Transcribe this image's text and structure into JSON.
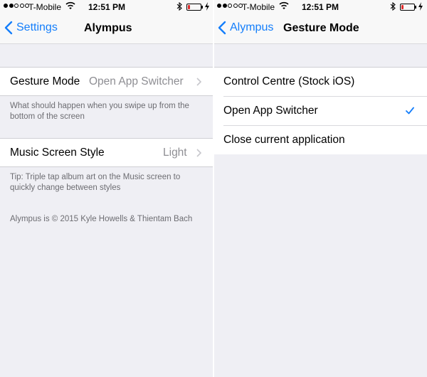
{
  "colors": {
    "accent": "#147efb",
    "battery_low": "#e02b2b",
    "background": "#efeff4"
  },
  "status_bar": {
    "carrier": "T-Mobile",
    "time": "12:51 PM"
  },
  "left_screen": {
    "nav": {
      "back_label": "Settings",
      "title": "Alympus"
    },
    "gesture_cell": {
      "label": "Gesture Mode",
      "value": "Open App Switcher"
    },
    "gesture_footer": "What should happen when you swipe up from the bottom of the screen",
    "music_cell": {
      "label": "Music Screen Style",
      "value": "Light"
    },
    "music_footer": "Tip: Triple tap album art on the Music screen to quickly change between styles",
    "copyright": "Alympus is © 2015 Kyle Howells & Thientam Bach"
  },
  "right_screen": {
    "nav": {
      "back_label": "Alympus",
      "title": "Gesture Mode"
    },
    "options": [
      {
        "label": "Control Centre (Stock iOS)",
        "selected": false
      },
      {
        "label": "Open App Switcher",
        "selected": true
      },
      {
        "label": "Close current application",
        "selected": false
      }
    ]
  }
}
